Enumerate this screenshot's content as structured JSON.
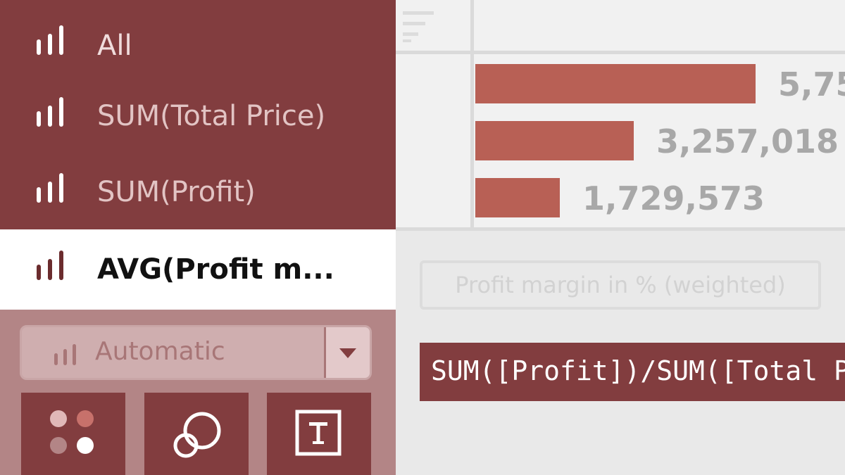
{
  "marks_card": {
    "items": [
      {
        "label": "All",
        "active": false,
        "icon": "bar-chart-icon"
      },
      {
        "label": "SUM(Total Price)",
        "active": false,
        "icon": "bar-chart-icon"
      },
      {
        "label": "SUM(Profit)",
        "active": false,
        "icon": "bar-chart-icon"
      },
      {
        "label": "AVG(Profit m...",
        "active": true,
        "icon": "bar-chart-icon"
      }
    ],
    "mark_type": {
      "label": "Automatic",
      "icon": "bar-chart-icon",
      "dropdown_icon": "caret-down-icon"
    },
    "buttons": [
      {
        "name": "color",
        "icon": "color-dots-icon"
      },
      {
        "name": "size",
        "icon": "size-circles-icon"
      },
      {
        "name": "text",
        "icon": "text-label-icon"
      }
    ]
  },
  "view": {
    "sort_icon": "sort-descending-icon",
    "bars": [
      {
        "value": 5750000,
        "label": "5,75"
      },
      {
        "value": 3257018,
        "label": "3,257,018"
      },
      {
        "value": 1729573,
        "label": "1,729,573"
      }
    ],
    "bar_color": "#b86055"
  },
  "filter_pill": {
    "label": "Profit margin in % (weighted)"
  },
  "formula": {
    "text": "SUM([Profit])/SUM([Total Pr"
  },
  "colors": {
    "accent": "#823d3f",
    "active_bg": "#ffffff",
    "panel_light": "#b38586"
  }
}
